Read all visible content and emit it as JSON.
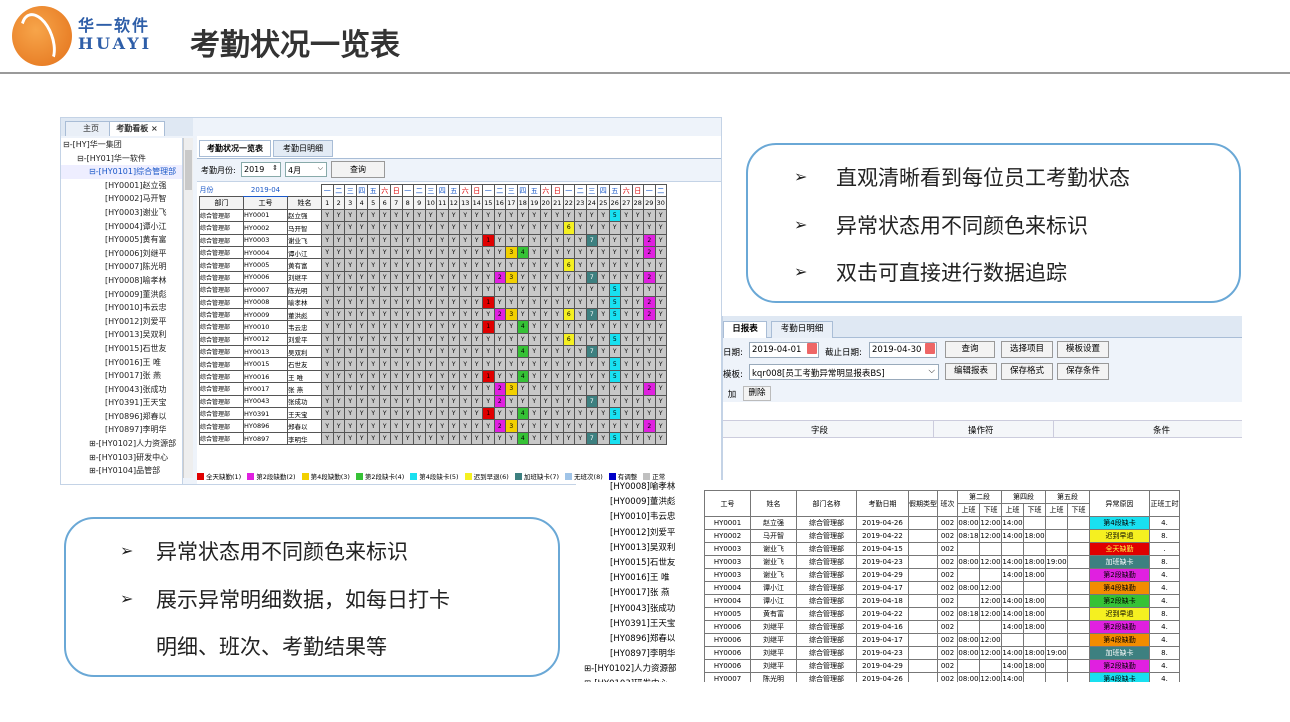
{
  "header": {
    "logo_cn": "华一软件",
    "logo_en": "HUAYI",
    "title": "考勤状况一览表"
  },
  "callout_top": {
    "bullet": "➢",
    "items": [
      "直观清晰看到每位员工考勤状态",
      "异常状态用不同颜色来标识",
      "双击可直接进行数据追踪"
    ]
  },
  "callout_bottom": {
    "bullet": "➢",
    "items": [
      "异常状态用不同颜色来标识",
      "展示异常明细数据，如每日打卡",
      "明细、班次、考勤结果等"
    ]
  },
  "shot1": {
    "outer_tabs": [
      "主页",
      "考勤看板 ×"
    ],
    "tree": [
      "⊟-[HY]华一集团",
      "⊟-[HY01]华一软件",
      "⊟-[HY0101]综合管理部",
      "[HY0001]赵立强",
      "[HY0002]马开智",
      "[HY0003]谢业飞",
      "[HY0004]谭小江",
      "[HY0005]黄有富",
      "[HY0006]刘继平",
      "[HY0007]陈光明",
      "[HY0008]喻孝林",
      "[HY0009]董洪彪",
      "[HY0010]韦云忠",
      "[HY0012]刘爱平",
      "[HY0013]吴双利",
      "[HY0015]石世友",
      "[HY0016]王 唯",
      "[HY0017]张 燕",
      "[HY0043]张成功",
      "[HY0391]王天宝",
      "[HY0896]郑春以",
      "[HY0897]李明华",
      "⊞-[HY0102]人力资源部",
      "⊞-[HY0103]研发中心",
      "⊞-[HY0104]品管部"
    ],
    "inner_tabs": [
      "考勤状况一览表",
      "考勤日明细"
    ],
    "query_label": "考勤月份:",
    "year": "2019",
    "month": "4月",
    "query_btn": "查询",
    "month_label": "月份",
    "month_value": "2019-04",
    "weekdays": [
      "一",
      "二",
      "三",
      "四",
      "五",
      "六",
      "日",
      "一",
      "二",
      "三",
      "四",
      "五",
      "六",
      "日",
      "一",
      "二",
      "三",
      "四",
      "五",
      "六",
      "日",
      "一",
      "二",
      "三",
      "四",
      "五",
      "六",
      "日",
      "一",
      "二"
    ],
    "col_dept": "部门",
    "col_id": "工号",
    "col_name": "姓名",
    "dept": "综合管理部",
    "employees": [
      {
        "id": "HY0001",
        "name": "赵立强",
        "marks": {
          "26": "5"
        }
      },
      {
        "id": "HY0002",
        "name": "马开智",
        "marks": {
          "22": "6"
        }
      },
      {
        "id": "HY0003",
        "name": "谢业飞",
        "marks": {
          "15": "1",
          "24": "7",
          "29": "2"
        }
      },
      {
        "id": "HY0004",
        "name": "谭小江",
        "marks": {
          "17": "3",
          "18": "4",
          "29": "2"
        }
      },
      {
        "id": "HY0005",
        "name": "黄有富",
        "marks": {
          "22": "6"
        }
      },
      {
        "id": "HY0006",
        "name": "刘继平",
        "marks": {
          "16": "2",
          "17": "3",
          "24": "7",
          "29": "2"
        }
      },
      {
        "id": "HY0007",
        "name": "陈光明",
        "marks": {
          "26": "5"
        }
      },
      {
        "id": "HY0008",
        "name": "喻孝林",
        "marks": {
          "15": "1",
          "26": "5",
          "29": "2"
        }
      },
      {
        "id": "HY0009",
        "name": "董洪彪",
        "marks": {
          "16": "2",
          "17": "3",
          "22": "6",
          "24": "7",
          "26": "5",
          "29": "2"
        }
      },
      {
        "id": "HY0010",
        "name": "韦云忠",
        "marks": {
          "15": "1",
          "18": "4"
        }
      },
      {
        "id": "HY0012",
        "name": "刘爱平",
        "marks": {
          "22": "6",
          "26": "5"
        }
      },
      {
        "id": "HY0013",
        "name": "吴双利",
        "marks": {
          "18": "4",
          "24": "7"
        }
      },
      {
        "id": "HY0015",
        "name": "石世友",
        "marks": {
          "26": "5"
        }
      },
      {
        "id": "HY0016",
        "name": "王 唯",
        "marks": {
          "15": "1",
          "18": "4",
          "26": "5"
        }
      },
      {
        "id": "HY0017",
        "name": "张 燕",
        "marks": {
          "16": "2",
          "17": "3",
          "29": "2"
        }
      },
      {
        "id": "HY0043",
        "name": "张成功",
        "marks": {
          "16": "2",
          "24": "7"
        }
      },
      {
        "id": "HY0391",
        "name": "王天宝",
        "marks": {
          "15": "1",
          "18": "4",
          "26": "5"
        }
      },
      {
        "id": "HY0896",
        "name": "郑春以",
        "marks": {
          "16": "2",
          "17": "3",
          "29": "2"
        }
      },
      {
        "id": "HY0897",
        "name": "李明华",
        "marks": {
          "18": "4",
          "24": "7",
          "26": "5"
        }
      }
    ],
    "legend": [
      {
        "label": "全天缺勤(1)",
        "color": "#e00000"
      },
      {
        "label": "第2段缺勤(2)",
        "color": "#e020e0"
      },
      {
        "label": "第4段缺勤(3)",
        "color": "#f2d000"
      },
      {
        "label": "第2段缺卡(4)",
        "color": "#36c236"
      },
      {
        "label": "第4段缺卡(5)",
        "color": "#19e0f0"
      },
      {
        "label": "迟到早退(6)",
        "color": "#f5f020"
      },
      {
        "label": "加班缺卡(7)",
        "color": "#3d8080"
      },
      {
        "label": "无班次(8)",
        "color": "#a0c4e8"
      },
      {
        "label": "有调整",
        "color": "#0000c8"
      },
      {
        "label": "正常",
        "color": "#c0c0c0"
      }
    ],
    "mark_colors": {
      "1": "#e00000",
      "2": "#e020e0",
      "3": "#f2d000",
      "4": "#36c236",
      "5": "#19e0f0",
      "6": "#f5f020",
      "7": "#3d8080"
    },
    "normal_mark": "Y"
  },
  "shot2": {
    "tabs": [
      "日报表",
      "考勤日明细"
    ],
    "start_label": "日期:",
    "start": "2019-04-01",
    "end_label": "截止日期:",
    "end": "2019-04-30",
    "btn_query": "查询",
    "btn_select": "选择项目",
    "btn_template": "模板设置",
    "tpl_label": "模板:",
    "tpl_value": "kqr008[员工考勤异常明显报表BS]",
    "btn_edit": "编辑报表",
    "btn_save_fmt": "保存格式",
    "btn_save_cond": "保存条件",
    "btn_add": "加",
    "btn_del": "删除",
    "cols": [
      "字段",
      "操作符",
      "条件"
    ]
  },
  "shot3": {
    "tree": [
      "[HY0008]喻孝林",
      "[HY0009]董洪彪",
      "[HY0010]韦云忠",
      "[HY0012]刘爱平",
      "[HY0013]吴双利",
      "[HY0015]石世友",
      "[HY0016]王 唯",
      "[HY0017]张 燕",
      "[HY0043]张成功",
      "[HY0391]王天宝",
      "[HY0896]郑春以",
      "[HY0897]李明华",
      "⊞-[HY0102]人力资源部",
      "⊞-[HY0103]研发中心"
    ],
    "headers": [
      "工号",
      "姓名",
      "部门名称",
      "考勤日期",
      "假期类型",
      "班次",
      "第二段",
      "第四段",
      "第五段",
      "异常原因",
      "正班工时"
    ],
    "subheaders": [
      "上班",
      "下班",
      "上班",
      "下班",
      "上班",
      "下班"
    ],
    "rows": [
      [
        "HY0001",
        "赵立强",
        "综合管理部",
        "2019-04-26",
        "",
        "002",
        "08:00",
        "12:00",
        "14:00",
        "",
        "",
        "",
        "第4段缺卡",
        "4."
      ],
      [
        "HY0002",
        "马开智",
        "综合管理部",
        "2019-04-22",
        "",
        "002",
        "08:18",
        "12:00",
        "14:00",
        "18:00",
        "",
        "",
        "迟到早退",
        "8."
      ],
      [
        "HY0003",
        "谢业飞",
        "综合管理部",
        "2019-04-15",
        "",
        "002",
        "",
        "",
        "",
        "",
        "",
        "",
        "全天缺勤",
        "."
      ],
      [
        "HY0003",
        "谢业飞",
        "综合管理部",
        "2019-04-23",
        "",
        "002",
        "08:00",
        "12:00",
        "14:00",
        "18:00",
        "19:00",
        "",
        "加班缺卡",
        "8."
      ],
      [
        "HY0003",
        "谢业飞",
        "综合管理部",
        "2019-04-29",
        "",
        "002",
        "",
        "",
        "14:00",
        "18:00",
        "",
        "",
        "第2段缺勤",
        "4."
      ],
      [
        "HY0004",
        "谭小江",
        "综合管理部",
        "2019-04-17",
        "",
        "002",
        "08:00",
        "12:00",
        "",
        "",
        "",
        "",
        "第4段缺勤",
        "4."
      ],
      [
        "HY0004",
        "谭小江",
        "综合管理部",
        "2019-04-18",
        "",
        "002",
        "",
        "12:00",
        "14:00",
        "18:00",
        "",
        "",
        "第2段缺卡",
        "4."
      ],
      [
        "HY0005",
        "黄有富",
        "综合管理部",
        "2019-04-22",
        "",
        "002",
        "08:18",
        "12:00",
        "14:00",
        "18:00",
        "",
        "",
        "迟到早退",
        "8."
      ],
      [
        "HY0006",
        "刘继平",
        "综合管理部",
        "2019-04-16",
        "",
        "002",
        "",
        "",
        "14:00",
        "18:00",
        "",
        "",
        "第2段缺勤",
        "4."
      ],
      [
        "HY0006",
        "刘继平",
        "综合管理部",
        "2019-04-17",
        "",
        "002",
        "08:00",
        "12:00",
        "",
        "",
        "",
        "",
        "第4段缺勤",
        "4."
      ],
      [
        "HY0006",
        "刘继平",
        "综合管理部",
        "2019-04-23",
        "",
        "002",
        "08:00",
        "12:00",
        "14:00",
        "18:00",
        "19:00",
        "",
        "加班缺卡",
        "8."
      ],
      [
        "HY0006",
        "刘继平",
        "综合管理部",
        "2019-04-29",
        "",
        "002",
        "",
        "",
        "14:00",
        "18:00",
        "",
        "",
        "第2段缺勤",
        "4."
      ],
      [
        "HY0007",
        "陈光明",
        "综合管理部",
        "2019-04-26",
        "",
        "002",
        "08:00",
        "12:00",
        "14:00",
        "",
        "",
        "",
        "第4段缺卡",
        "4."
      ]
    ],
    "reason_colors": {
      "第4段缺卡": "#19e0f0",
      "迟到早退": "#f5f020",
      "全天缺勤": "#e00000",
      "加班缺卡": "#3d8080",
      "第2段缺勤": "#e020e0",
      "第4段缺勤": "#f28c00",
      "第2段缺卡": "#36c236"
    }
  }
}
